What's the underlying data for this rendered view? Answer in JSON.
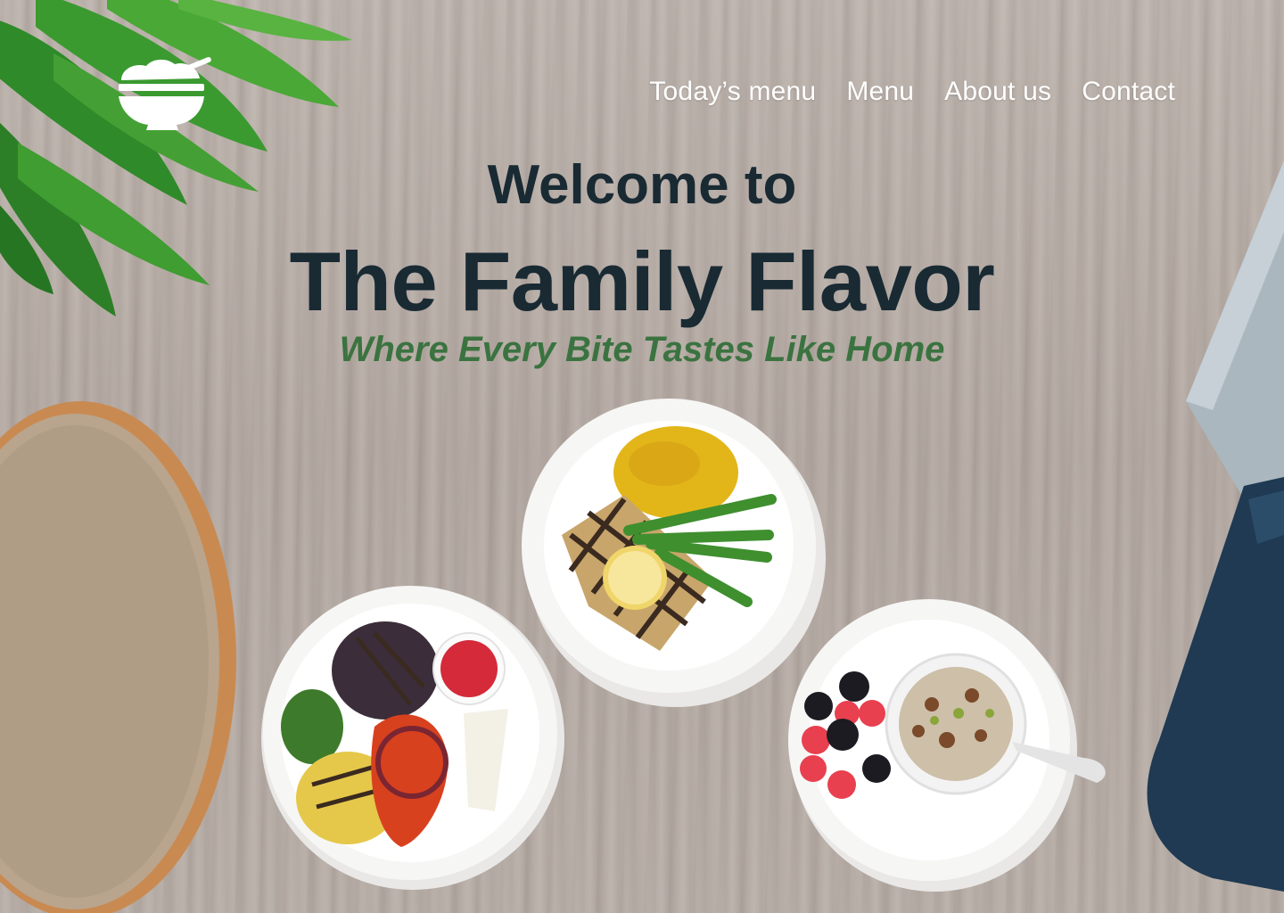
{
  "logo": {
    "icon": "bowl-icon",
    "color": "#ffffff"
  },
  "nav": {
    "items": [
      {
        "label": "Today’s menu"
      },
      {
        "label": "Menu"
      },
      {
        "label": "About us"
      },
      {
        "label": "Contact"
      }
    ]
  },
  "hero": {
    "welcome": "Welcome to",
    "title": "The Family Flavor",
    "tagline": "Where Every Bite Tastes Like Home"
  },
  "colors": {
    "heading": "#192a33",
    "tagline": "#3b7340",
    "nav_text": "#ffffff",
    "table": "#b7aca5"
  },
  "decor": [
    "leaves-decoration",
    "bread-decoration",
    "knife-decoration"
  ],
  "dishes": [
    "grilled-tofu-plate",
    "grilled-vegetable-plate",
    "oatmeal-berries-plate"
  ]
}
